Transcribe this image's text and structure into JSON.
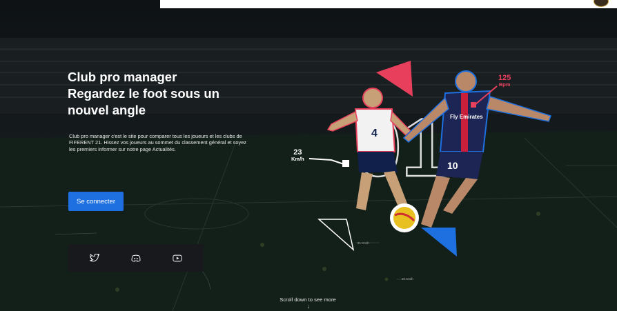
{
  "hero": {
    "title_lines": [
      "Club pro manager",
      "Regardez le foot sous un",
      "nouvel angle"
    ],
    "description": "Club pro manager c'est le site pour comparer tous les joueurs et les clubs de FIFERENT 21. Hissez vos joueurs au sommet du classement général et soyez les premiers informer sur notre page Actualités."
  },
  "login": {
    "label": "Se connecter"
  },
  "social": [
    {
      "network": "twitter",
      "icon": "twitter-icon"
    },
    {
      "network": "discord",
      "icon": "discord-icon"
    },
    {
      "network": "youtube",
      "icon": "youtube-icon"
    }
  ],
  "stats": {
    "speed": {
      "value": "23",
      "unit": "Km/h"
    },
    "heart_rate": {
      "value": "125",
      "unit": "Bpm"
    },
    "mini_speed_1": "21 Km/h",
    "mini_speed_2": "20 Km/h"
  },
  "players": {
    "left_shirt_number": "4",
    "right_shirt_number": "10",
    "sponsor": "Fly Emirates",
    "watermark_number": "01"
  },
  "scroll": {
    "label": "Scroll down to see more",
    "arrow": "↓"
  },
  "colors": {
    "accent_blue": "#1e70e0",
    "accent_red": "#e8405c",
    "background": "#111517",
    "social_bar": "#17191c"
  }
}
